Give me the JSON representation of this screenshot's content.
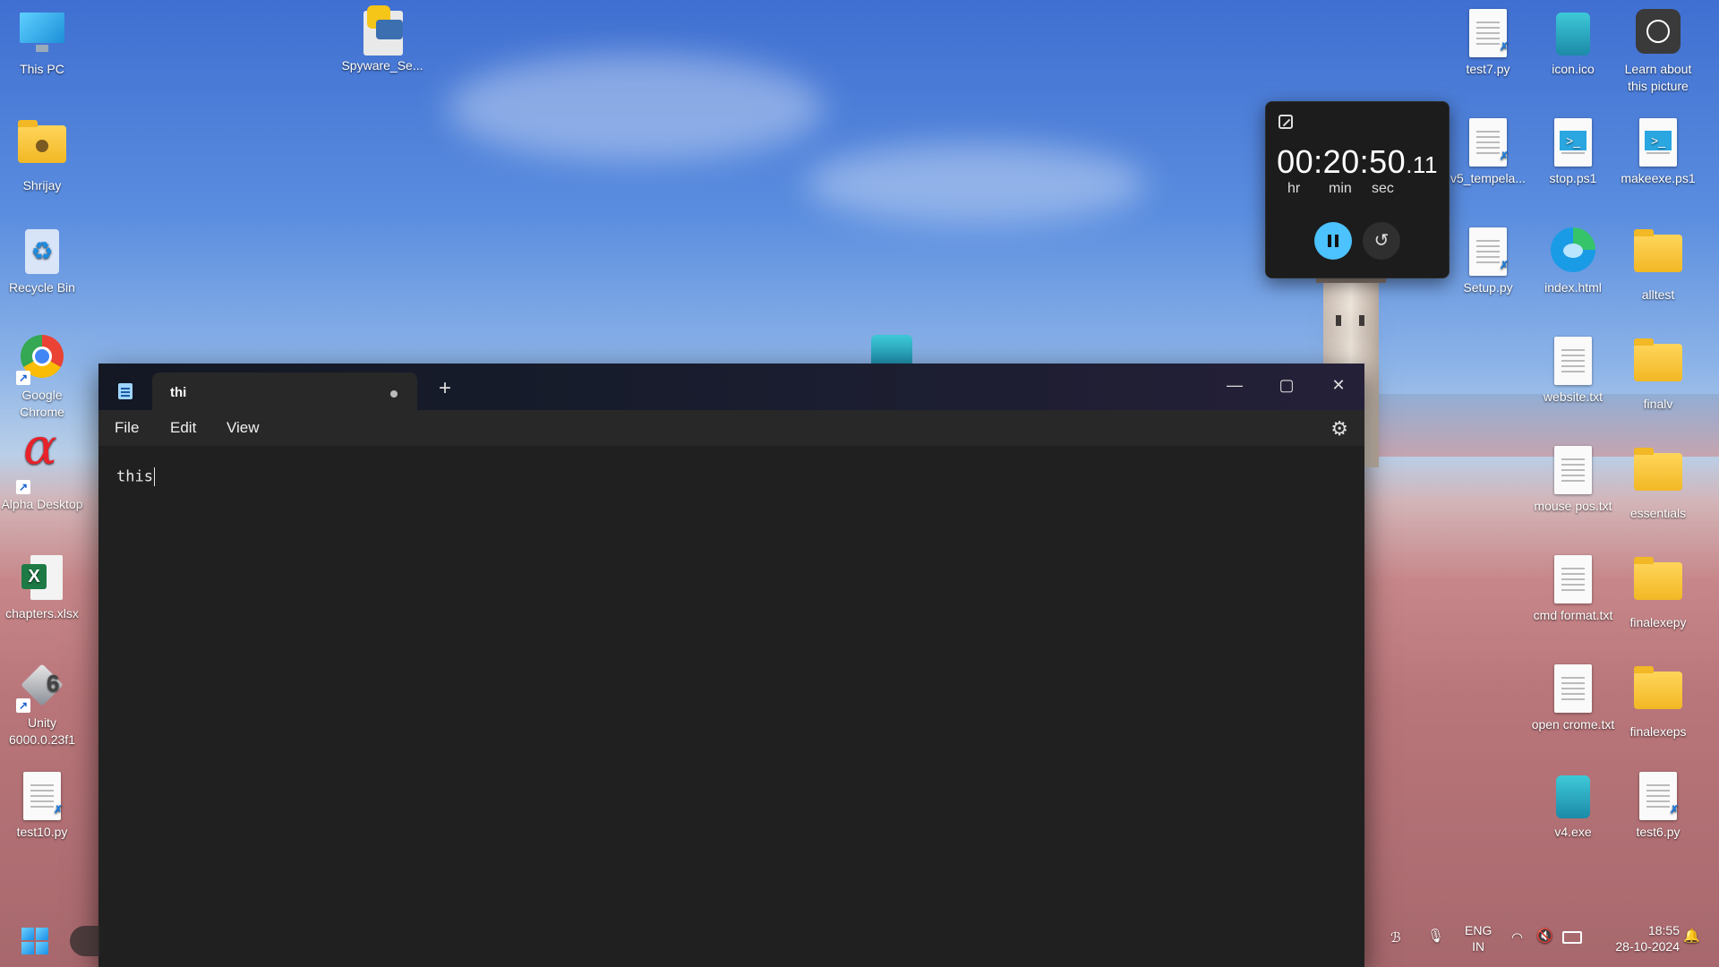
{
  "desktop": {
    "left_icons": [
      {
        "label": "This PC",
        "icon": "monitor-icon"
      },
      {
        "label": "Shrijay",
        "icon": "user-folder-icon"
      },
      {
        "label": "Recycle Bin",
        "icon": "recycle-bin-icon"
      },
      {
        "label": "Google Chrome",
        "icon": "chrome-icon"
      },
      {
        "label": "Alpha Desktop",
        "icon": "alpha-icon"
      },
      {
        "label": "chapters.xlsx",
        "icon": "excel-icon"
      },
      {
        "label": "Unity 6000.0.23f1",
        "icon": "unity-icon"
      },
      {
        "label": "test10.py",
        "icon": "python-file-icon"
      }
    ],
    "top_icons": [
      {
        "label": "Spyware_Se...",
        "icon": "python-file-icon"
      }
    ],
    "right_icons": [
      {
        "label": "test7.py",
        "icon": "python-file-icon"
      },
      {
        "label": "icon.ico",
        "icon": "notepad-icon"
      },
      {
        "label": "Learn about this picture",
        "icon": "camera-icon"
      },
      {
        "label": "v5_tempela...",
        "icon": "python-file-icon"
      },
      {
        "label": "stop.ps1",
        "icon": "powershell-icon"
      },
      {
        "label": "makeexe.ps1",
        "icon": "powershell-icon"
      },
      {
        "label": "Setup.py",
        "icon": "python-file-icon"
      },
      {
        "label": "index.html",
        "icon": "edge-icon"
      },
      {
        "label": "alltest",
        "icon": "folder-icon"
      },
      {
        "label": "website.txt",
        "icon": "text-file-icon"
      },
      {
        "label": "finalv",
        "icon": "folder-icon"
      },
      {
        "label": "mouse pos.txt",
        "icon": "text-file-icon"
      },
      {
        "label": "essentials",
        "icon": "folder-icon"
      },
      {
        "label": "cmd format.txt",
        "icon": "text-file-icon"
      },
      {
        "label": "finalexepy",
        "icon": "folder-icon"
      },
      {
        "label": "open crome.txt",
        "icon": "text-file-icon"
      },
      {
        "label": "finalexeps",
        "icon": "folder-icon"
      },
      {
        "label": "v4.exe",
        "icon": "notepad-icon"
      },
      {
        "label": "test6.py",
        "icon": "python-file-icon"
      }
    ]
  },
  "timer": {
    "time": "00:20:50",
    "centiseconds": ".11",
    "units": {
      "hr": "hr",
      "min": "min",
      "sec": "sec"
    }
  },
  "notepad": {
    "tab_title": "thi",
    "menu": {
      "file": "File",
      "edit": "Edit",
      "view": "View"
    },
    "content": "this"
  },
  "taskbar": {
    "lang_line1": "ENG",
    "lang_line2": "IN",
    "clock_time": "18:55",
    "clock_date": "28-10-2024"
  },
  "colors": {
    "accent": "#4cc2ff",
    "window_bg": "#202020",
    "menu_bg": "#282828"
  }
}
